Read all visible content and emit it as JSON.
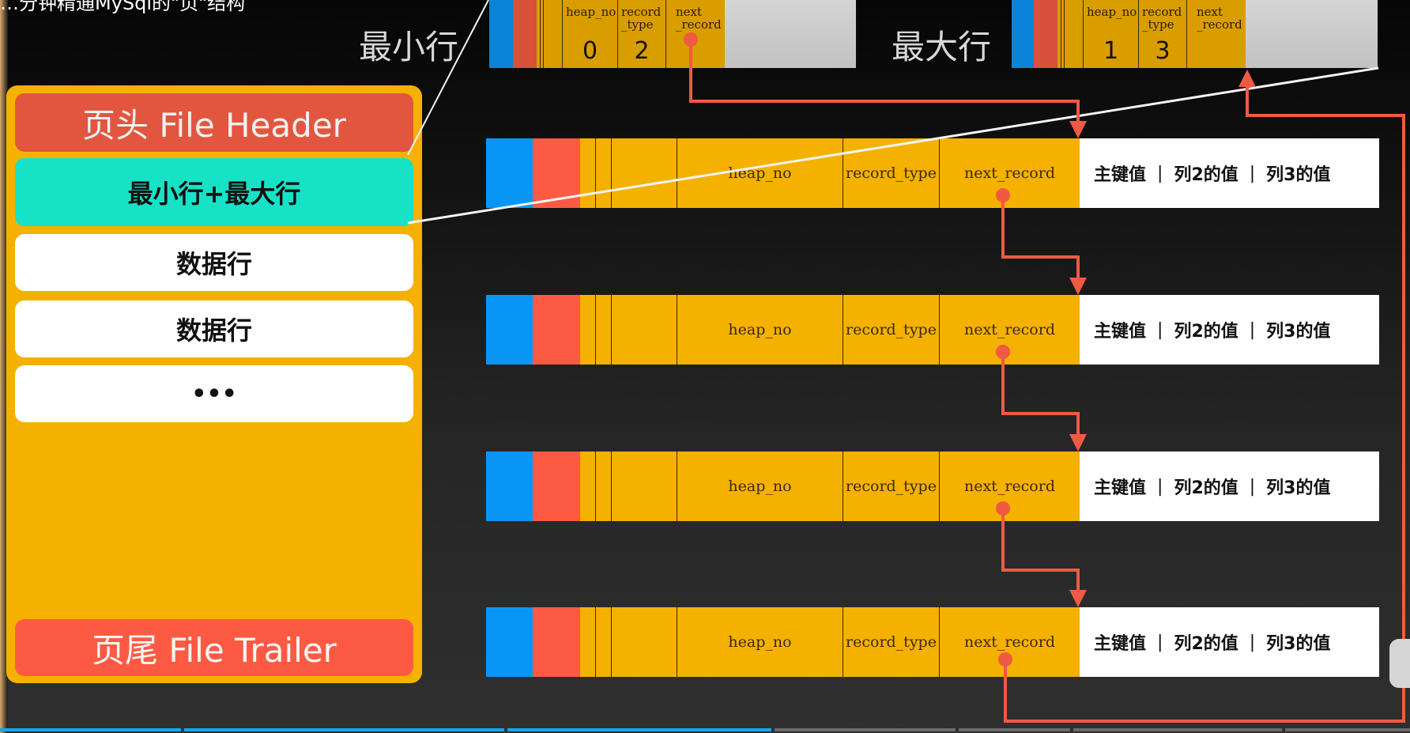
{
  "video_title": "…分钟精通MySql的\"页\"结构",
  "page_structure": {
    "header": "页头 File Header",
    "min_max": "最小行+最大行",
    "data_rows": [
      "数据行",
      "数据行"
    ],
    "ellipsis": "•••",
    "trailer": "页尾 File Trailer"
  },
  "min_row": {
    "label": "最小行",
    "fields": {
      "heap_no_label": "heap_no",
      "record_type_label_1": "record",
      "record_type_label_2": "_type",
      "next_label_1": "next",
      "next_label_2": "_record"
    },
    "heap_no": "0",
    "record_type": "2"
  },
  "max_row": {
    "label": "最大行",
    "fields": {
      "heap_no_label": "heap_no",
      "record_type_label_1": "record",
      "record_type_label_2": "_type",
      "next_label_1": "next",
      "next_label_2": "_record"
    },
    "heap_no": "1",
    "record_type": "3"
  },
  "records": [
    {
      "heap_no": "heap_no",
      "record_type": "record_type",
      "next_record": "next_record",
      "pk": "主键值",
      "col2": "列2的值",
      "col3": "列3的值",
      "sep": "|"
    },
    {
      "heap_no": "heap_no",
      "record_type": "record_type",
      "next_record": "next_record",
      "pk": "主键值",
      "col2": "列2的值",
      "col3": "列3的值",
      "sep": "|"
    },
    {
      "heap_no": "heap_no",
      "record_type": "record_type",
      "next_record": "next_record",
      "pk": "主键值",
      "col2": "列2的值",
      "col3": "列3的值",
      "sep": "|"
    },
    {
      "heap_no": "heap_no",
      "record_type": "record_type",
      "next_record": "next_record",
      "pk": "主键值",
      "col2": "列2的值",
      "col3": "列3的值",
      "sep": "|"
    }
  ],
  "colors": {
    "pointer": "#f05a43",
    "header": "#e2563f",
    "minmax": "#17e2c6",
    "panel": "#f5b100",
    "blue": "#0a96f5"
  },
  "video_progress": 0.55
}
